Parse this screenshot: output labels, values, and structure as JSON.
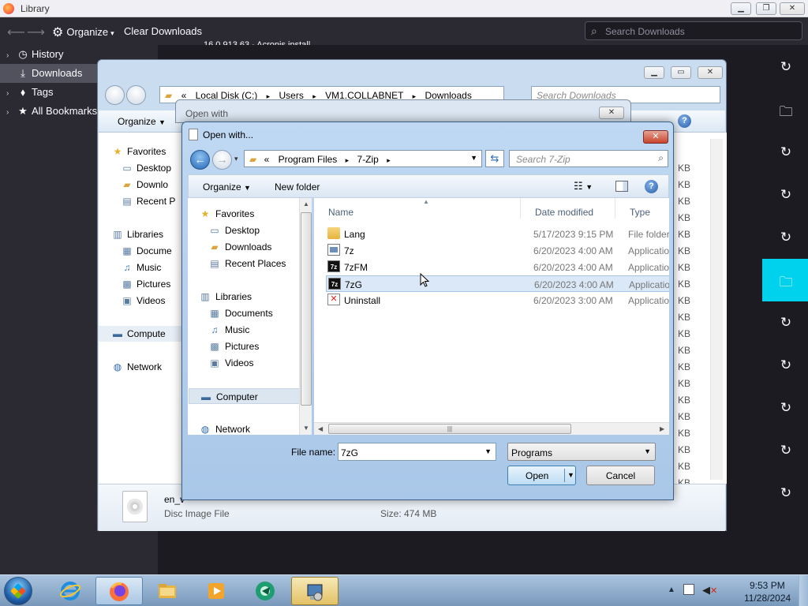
{
  "library": {
    "title": "Library",
    "toolbar": {
      "organize": "Organize",
      "clear_downloads": "Clear Downloads",
      "search_placeholder": "Search Downloads"
    },
    "sidebar": [
      {
        "label": "History",
        "icon": "clock-icon"
      },
      {
        "label": "Downloads",
        "icon": "download-icon",
        "selected": true
      },
      {
        "label": "Tags",
        "icon": "tag-icon"
      },
      {
        "label": "All Bookmarks",
        "icon": "star-icon"
      }
    ],
    "list_stub": "16.0.913.63 · Acronis install",
    "download_rows": 11,
    "selected_row": 5,
    "accent": "#00d2ee"
  },
  "explorer": {
    "address": {
      "root": "«",
      "parts": [
        "Local Disk (C:)",
        "Users",
        "VM1.COLLABNET",
        "Downloads"
      ]
    },
    "search_placeholder": "Search Downloads",
    "organize": "Organize",
    "nav": [
      {
        "label": "Favorites",
        "icon": "star-icon"
      },
      {
        "label": "Desktop",
        "icon": "desktop-icon"
      },
      {
        "label": "Downlo",
        "icon": "downloads-folder-icon"
      },
      {
        "label": "Recent P",
        "icon": "recent-places-icon"
      },
      {
        "label": "Libraries",
        "icon": "libraries-icon"
      },
      {
        "label": "Docume",
        "icon": "documents-icon"
      },
      {
        "label": "Music",
        "icon": "music-icon"
      },
      {
        "label": "Pictures",
        "icon": "pictures-icon"
      },
      {
        "label": "Videos",
        "icon": "videos-icon"
      },
      {
        "label": "Compute",
        "icon": "computer-icon"
      },
      {
        "label": "Network",
        "icon": "network-icon"
      }
    ],
    "size_unit": "KB",
    "details": {
      "name": "en_v",
      "type": "Disc Image File",
      "size": "Size: 474 MB"
    }
  },
  "open_with_back": {
    "title": "Open with"
  },
  "dialog": {
    "title": "Open with...",
    "address": {
      "root": "«",
      "parts": [
        "Program Files",
        "7-Zip"
      ]
    },
    "search_placeholder": "Search 7-Zip",
    "organize": "Organize",
    "new_folder": "New folder",
    "nav": [
      {
        "label": "Favorites",
        "icon": "star-icon",
        "top": true
      },
      {
        "label": "Desktop",
        "icon": "desktop-icon"
      },
      {
        "label": "Downloads",
        "icon": "downloads-folder-icon"
      },
      {
        "label": "Recent Places",
        "icon": "recent-places-icon"
      },
      {
        "label": "Libraries",
        "icon": "libraries-icon",
        "top": true
      },
      {
        "label": "Documents",
        "icon": "documents-icon"
      },
      {
        "label": "Music",
        "icon": "music-icon"
      },
      {
        "label": "Pictures",
        "icon": "pictures-icon"
      },
      {
        "label": "Videos",
        "icon": "videos-icon"
      },
      {
        "label": "Computer",
        "icon": "computer-icon",
        "top": true
      },
      {
        "label": "Network",
        "icon": "network-icon",
        "top": true
      }
    ],
    "columns": {
      "name": "Name",
      "date": "Date modified",
      "type": "Type"
    },
    "files": [
      {
        "name": "Lang",
        "date": "5/17/2023 9:15 PM",
        "type": "File folder",
        "icon": "folder-icon"
      },
      {
        "name": "7z",
        "date": "6/20/2023 4:00 AM",
        "type": "Application",
        "icon": "app-icon"
      },
      {
        "name": "7zFM",
        "date": "6/20/2023 4:00 AM",
        "type": "Application",
        "icon": "7zip-icon"
      },
      {
        "name": "7zG",
        "date": "6/20/2023 4:00 AM",
        "type": "Application",
        "icon": "7zip-icon",
        "selected": true
      },
      {
        "name": "Uninstall",
        "date": "6/20/2023 3:00 AM",
        "type": "Application",
        "icon": "uninstall-icon"
      }
    ],
    "file_name_label": "File name:",
    "file_name_value": "7zG",
    "file_type": "Programs",
    "open": "Open",
    "cancel": "Cancel"
  },
  "taskbar": {
    "apps": [
      "ie-icon",
      "firefox-icon",
      "explorer-icon",
      "media-player-icon",
      "green-app-icon",
      "setup-icon"
    ],
    "active_app": "firefox-icon",
    "time": "9:53 PM",
    "date": "11/28/2024"
  }
}
